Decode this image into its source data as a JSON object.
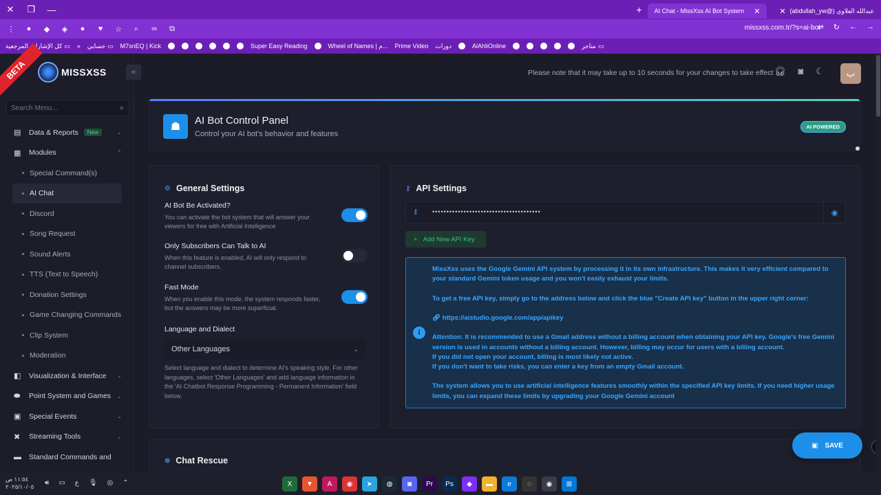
{
  "browser": {
    "tabs": [
      {
        "title": "(abdullah_yw@) عبدالله العلاوي",
        "active": false
      },
      {
        "title": "AI Chat - MissXss AI Bot System",
        "active": true
      }
    ],
    "url": "missxss.com.tr/?s=ai-bot",
    "bookmarks": [
      "كل الإشارات المرجعية",
      "حسابي",
      "M7snEQ | Kick",
      "Super Easy Reading",
      "Wheel of Names | م...",
      "Prime Video",
      "دورات",
      "AlAhliOnline",
      "متاجر"
    ]
  },
  "sidebar": {
    "beta": "BETA",
    "logo_text": "MISSXSS",
    "search_placeholder": "Search Menu...",
    "items": [
      {
        "label": "Data & Reports",
        "badge": "New",
        "icon": "chart-icon"
      },
      {
        "label": "Modules",
        "icon": "grid-icon"
      }
    ],
    "sub_items": [
      "Special Command(s)",
      "AI Chat",
      "Discord",
      "Song Request",
      "Sound Alerts",
      "TTS (Text to Speech)",
      "Donation Settings",
      "Game Changing Commands",
      "Clip System",
      "Moderation"
    ],
    "bottom_items": [
      "Visualization & Interface",
      "Point System and Games",
      "Special Events",
      "Streaming Tools",
      "Standard Commands and"
    ]
  },
  "topbar": {
    "notice": "Please note that it may take up to 10 seconds for your changes to take effect",
    "avatar_letter": "ب"
  },
  "header": {
    "title": "AI Bot Control Panel",
    "subtitle": "Control your AI bot's behavior and features",
    "badge": "AI POWERED"
  },
  "general": {
    "title": "General Settings",
    "options": [
      {
        "title": "AI Bot Be Activated?",
        "desc": "You can activate the bot system that will answer your viewers for free with Artificial Intelligence",
        "on": true
      },
      {
        "title": "Only Subscribers Can Talk to AI",
        "desc": "When this feature is enabled, AI will only respond to channel subscribers.",
        "on": false
      },
      {
        "title": "Fast Mode",
        "desc": "When you enable this mode, the system responds faster, but the answers may be more superficial.",
        "on": true
      }
    ],
    "lang_label": "Language and Dialect",
    "lang_value": "Other Languages",
    "lang_help": "Select language and dialect to determine AI's speaking style. For other languages, select 'Other Languages' and add language information in the 'AI Chatbot Response Programming - Permanent Information' field below."
  },
  "api": {
    "title": "API Settings",
    "key_masked": "••••••••••••••••••••••••••••••••••••••",
    "add_key": "Add New API Key",
    "info_p1": "MissXss uses the Google Gemini API system by processing it in its own infrastructure. This makes it very efficient compared to your standard Gemini token usage and you won't easily exhaust your limits.",
    "info_p2": "To get a free API key, simply go to the address below and click the blue \"Create API key\" button in the upper right corner:",
    "info_link": "https://aistudio.google.com/app/apikey",
    "info_p3a": "Attention: It is recommended to use a Gmail address without a billing account when obtaining your API key. Google's free Gemini version is used in accounts without a billing account. However, billing may occur for users with a billing account.",
    "info_p3b": "If you did not open your account, billing is most likely not active.",
    "info_p3c": "If you don't want to take risks, you can enter a key from an empty Gmail account.",
    "info_p4": "The system allows you to use artificial intelligence features smoothly within the specified API key limits. If you need higher usage limits, you can expand these limits by upgrading your Google Gemini account"
  },
  "rescue": {
    "title": "Chat Rescue"
  },
  "save_label": "SAVE",
  "taskbar": {
    "time": "١١:٥٤ ص",
    "date": "٢٠٢٥/١٠/٠٥",
    "lang": "ع"
  },
  "colors": {
    "accent": "#1e8fe8",
    "browser": "#8231d3",
    "success": "#3fbf7f"
  }
}
